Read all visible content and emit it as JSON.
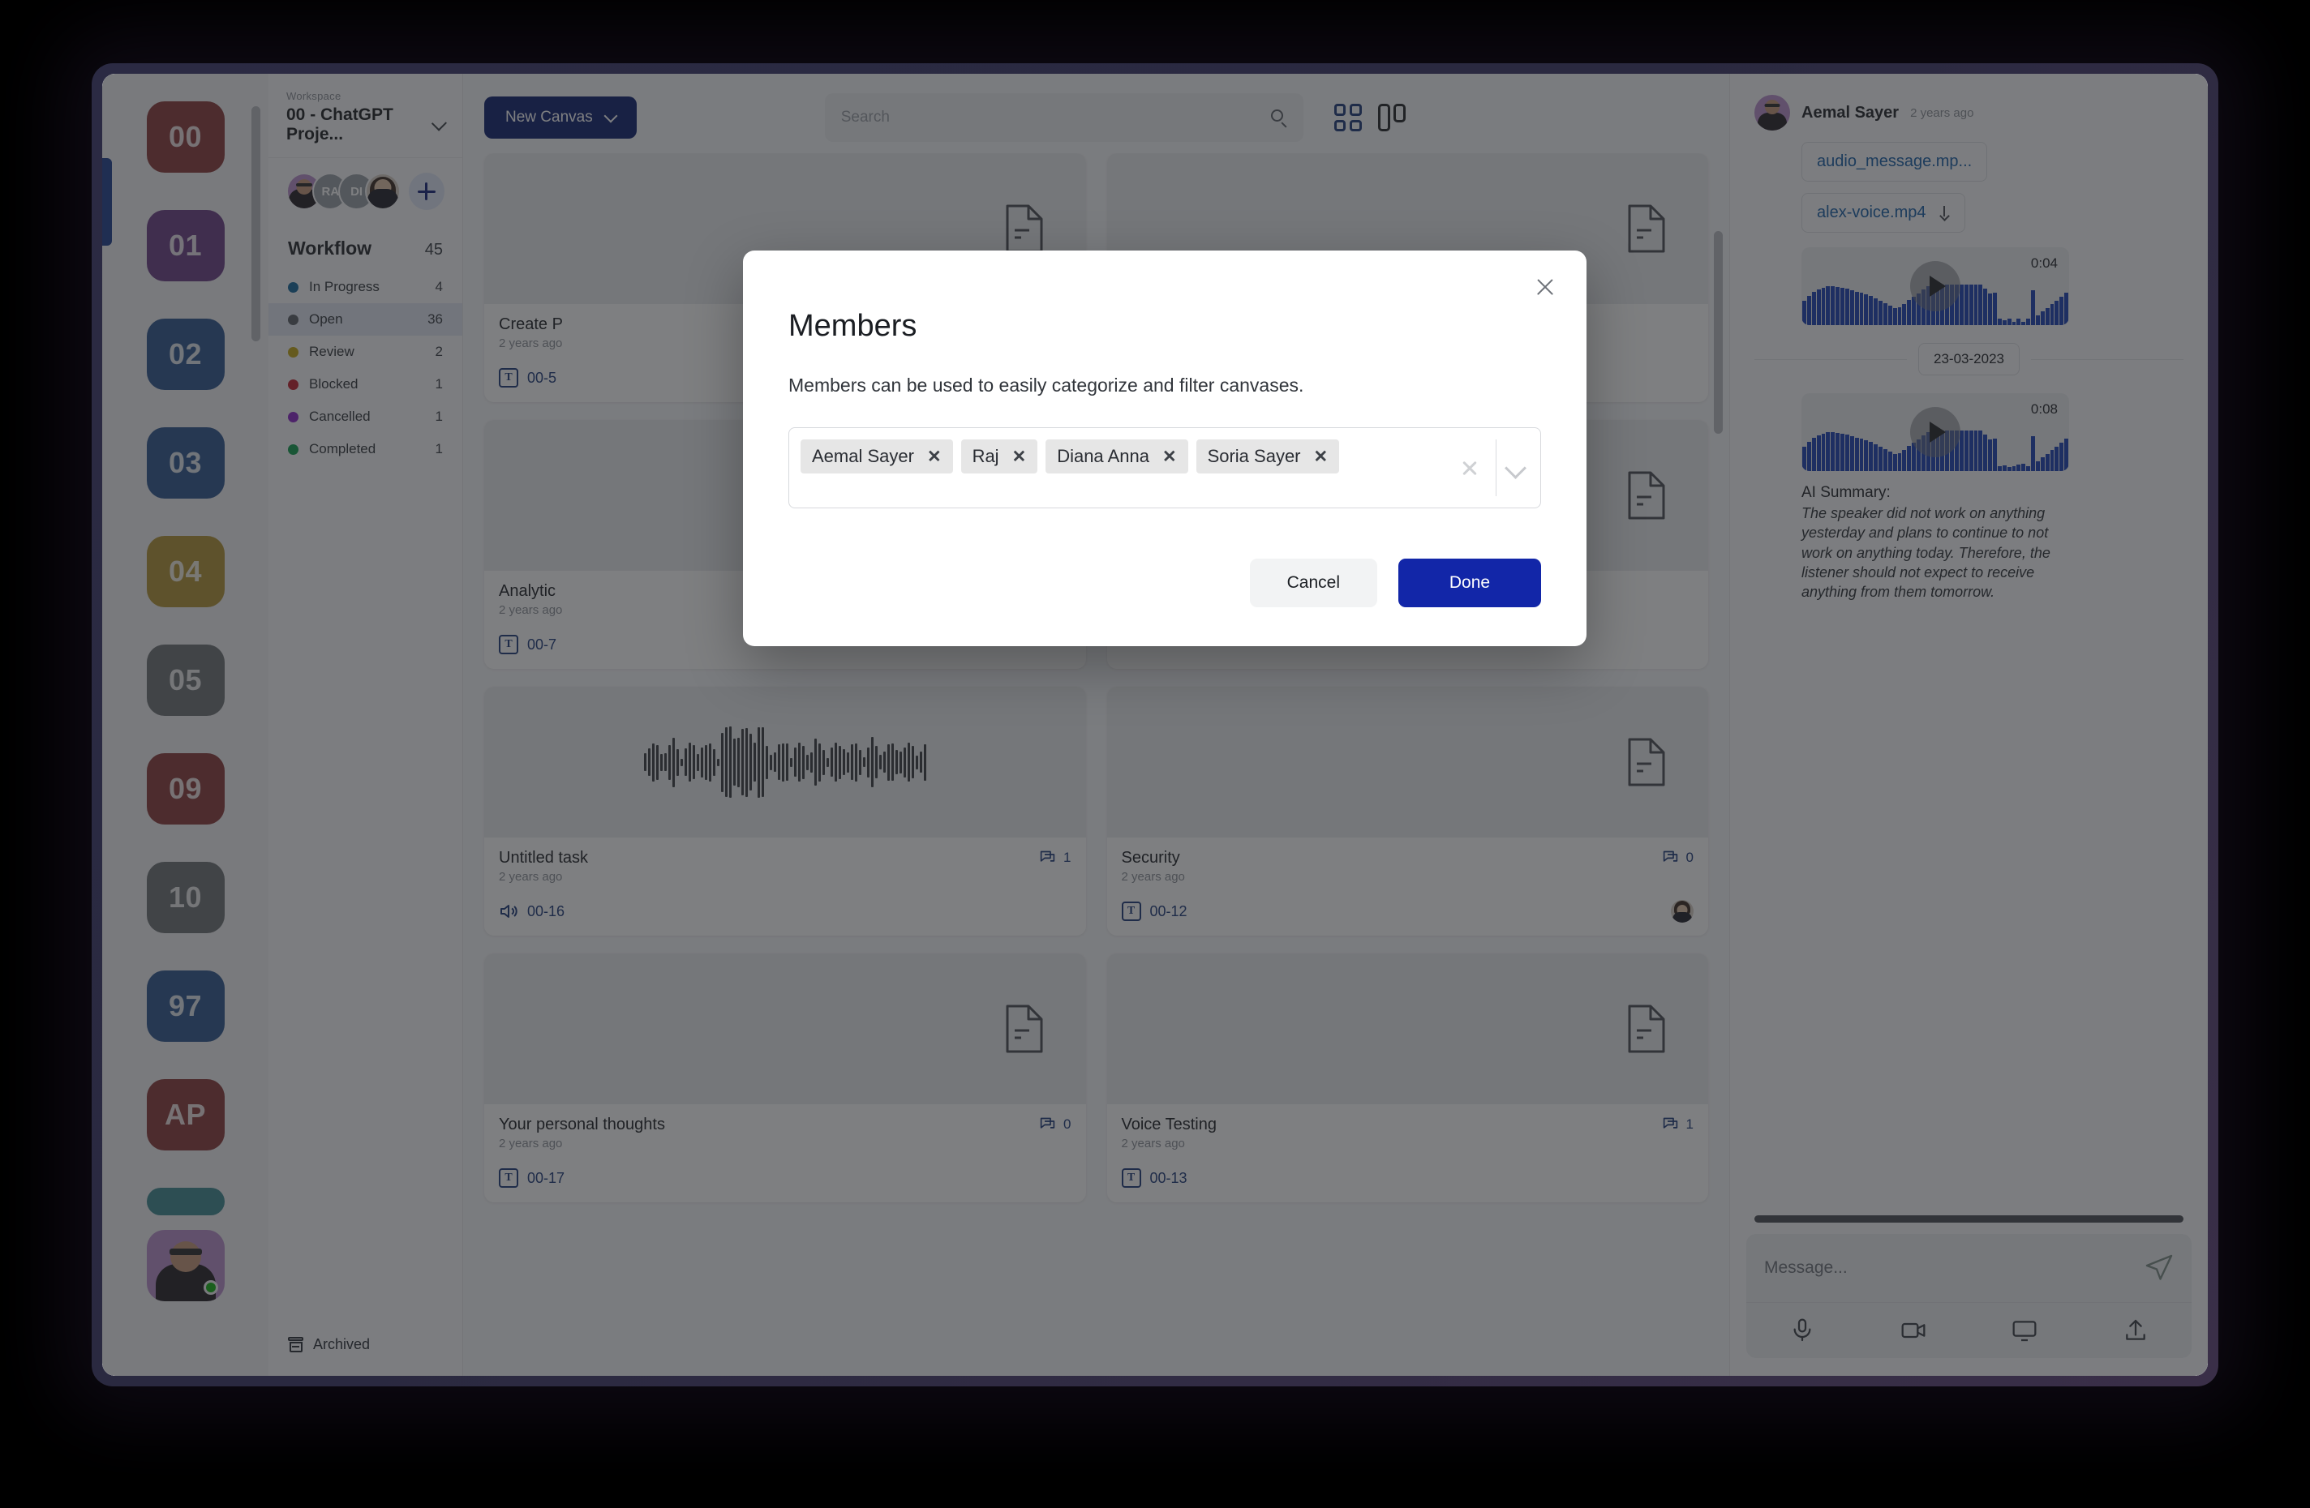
{
  "rail": {
    "tiles": [
      {
        "label": "00",
        "color": "#8a3a3a"
      },
      {
        "label": "01",
        "color": "#6b3e87"
      },
      {
        "label": "02",
        "color": "#2f568f"
      },
      {
        "label": "03",
        "color": "#2f568f"
      },
      {
        "label": "04",
        "color": "#b39535"
      },
      {
        "label": "05",
        "color": "#6f7276"
      },
      {
        "label": "09",
        "color": "#8a3a3a"
      },
      {
        "label": "10",
        "color": "#6f7276"
      },
      {
        "label": "97",
        "color": "#2f568f"
      },
      {
        "label": "AP",
        "color": "#8a3a3a"
      },
      {
        "label": "",
        "color": "#3f8a91"
      }
    ],
    "current_user_status": "online"
  },
  "sidebar": {
    "workspace_label": "Workspace",
    "workspace_name": "00 - ChatGPT Proje...",
    "avatars": [
      {
        "initials": "",
        "type": "photo"
      },
      {
        "initials": "RA",
        "type": "initials"
      },
      {
        "initials": "DI",
        "type": "initials"
      },
      {
        "initials": "",
        "type": "photo"
      }
    ],
    "add_member_label": "+",
    "workflow_title": "Workflow",
    "workflow_total": "45",
    "workflow_items": [
      {
        "label": "In Progress",
        "count": "4",
        "color": "#15689b",
        "active": false
      },
      {
        "label": "Open",
        "count": "36",
        "color": "#5b5f66",
        "active": true
      },
      {
        "label": "Review",
        "count": "2",
        "color": "#c3a613",
        "active": false
      },
      {
        "label": "Blocked",
        "count": "1",
        "color": "#c21f2e",
        "active": false
      },
      {
        "label": "Cancelled",
        "count": "1",
        "color": "#8b24c9",
        "active": false
      },
      {
        "label": "Completed",
        "count": "1",
        "color": "#0f9d4d",
        "active": false
      }
    ],
    "archived_label": "Archived"
  },
  "toolbar": {
    "new_canvas_label": "New Canvas",
    "search_placeholder": "Search",
    "search_value": "",
    "grid_view_icon": "grid-view-icon",
    "board_view_icon": "board-view-icon"
  },
  "cards": [
    {
      "title": "Create P",
      "date": "2 years ago",
      "comments": "",
      "tag": "00-5",
      "tag_type": "text",
      "thumb": "document",
      "has_avatar": false
    },
    {
      "title": "",
      "date": "",
      "comments": "",
      "tag": "",
      "tag_type": "text",
      "thumb": "document",
      "has_avatar": false
    },
    {
      "title": "Analytic",
      "date": "2 years ago",
      "comments": "",
      "tag": "00-7",
      "tag_type": "text",
      "thumb": "document",
      "has_avatar": false
    },
    {
      "title": "",
      "date": "",
      "comments": "",
      "tag": "",
      "tag_type": "text",
      "thumb": "document",
      "has_avatar": false
    },
    {
      "title": "Untitled task",
      "date": "2 years ago",
      "comments": "1",
      "tag": "00-16",
      "tag_type": "audio",
      "thumb": "waveform",
      "has_avatar": false
    },
    {
      "title": "Security",
      "date": "2 years ago",
      "comments": "0",
      "tag": "00-12",
      "tag_type": "text",
      "thumb": "document",
      "has_avatar": true
    },
    {
      "title": "Your personal thoughts",
      "date": "2 years ago",
      "comments": "0",
      "tag": "00-17",
      "tag_type": "text",
      "thumb": "document",
      "has_avatar": false
    },
    {
      "title": "Voice Testing",
      "date": "2 years ago",
      "comments": "1",
      "tag": "00-13",
      "tag_type": "text",
      "thumb": "document",
      "has_avatar": false
    }
  ],
  "chat": {
    "message_author": "Aemal Sayer",
    "message_time": "2 years ago",
    "attachments": [
      {
        "name": "audio_message.mp...",
        "downloadable": false
      },
      {
        "name": "alex-voice.mp4",
        "downloadable": true
      }
    ],
    "player_one_duration": "0:04",
    "date_separator": "23-03-2023",
    "player_two_duration": "0:08",
    "summary_heading": "AI Summary:",
    "summary_body": "The speaker did not work on anything yesterday and plans to continue to not work on anything today. Therefore, the listener should not expect to receive anything from them tomorrow.",
    "composer_placeholder": "Message...",
    "composer_value": "",
    "composer_icons": [
      "microphone-icon",
      "video-camera-icon",
      "screen-share-icon",
      "upload-icon"
    ],
    "send_icon": "send-icon"
  },
  "modal": {
    "title": "Members",
    "description": "Members can be used to easily categorize and filter canvases.",
    "chips": [
      {
        "label": "Aemal Sayer",
        "remove": "✕"
      },
      {
        "label": "Raj",
        "remove": "✕"
      },
      {
        "label": "Diana Anna",
        "remove": "✕"
      },
      {
        "label": "Soria Sayer",
        "remove": "✕"
      }
    ],
    "clear_all_icon": "clear-icon",
    "dropdown_icon": "chevron-down-icon",
    "close_icon": "close-icon",
    "cancel_label": "Cancel",
    "done_label": "Done"
  },
  "colors": {
    "accent_blue": "#1226a8",
    "dark_blue": "#0e1f6e",
    "link_blue": "#1e3a7a",
    "chat_link": "#1a5fa8",
    "waveform": "#1b42b5"
  }
}
